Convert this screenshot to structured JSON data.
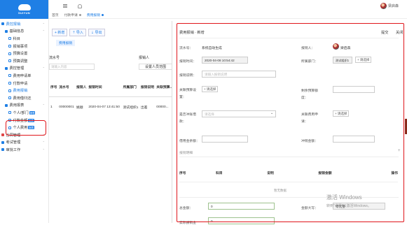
{
  "logo": {
    "brand": "SUIYUN"
  },
  "user": {
    "name": "梁启森"
  },
  "nav": {
    "items": [
      {
        "type": "group",
        "label": "费控报销",
        "icon": "expense-icon",
        "active": true
      },
      {
        "type": "sub",
        "label": "基础信息"
      },
      {
        "type": "leaf",
        "label": "科目"
      },
      {
        "type": "leaf",
        "label": "报销事项"
      },
      {
        "type": "leaf",
        "label": "预算设置"
      },
      {
        "type": "leaf",
        "label": "预算调整"
      },
      {
        "type": "sub",
        "label": "费控管理"
      },
      {
        "type": "leaf",
        "label": "费用申请单"
      },
      {
        "type": "leaf",
        "label": "付款申请"
      },
      {
        "type": "leaf",
        "label": "费用报销",
        "active": true
      },
      {
        "type": "leaf",
        "label": "费用借归还"
      },
      {
        "type": "sub",
        "label": "费用报表"
      },
      {
        "type": "leaf",
        "label": "个人/部门",
        "badge": "报表"
      },
      {
        "type": "leaf",
        "label": "付款金额",
        "badge": "报表"
      },
      {
        "type": "leaf",
        "label": "个人费用",
        "badge": "报表"
      },
      {
        "type": "group",
        "label": "合同管理"
      },
      {
        "type": "group",
        "label": "考试管理"
      },
      {
        "type": "group",
        "label": "审批工作"
      }
    ]
  },
  "tabs": [
    {
      "label": "首页",
      "active": false
    },
    {
      "label": "付款申请",
      "active": false
    },
    {
      "label": "费用报销",
      "active": true
    }
  ],
  "toolbar": {
    "add": "+ 新增",
    "import": "⇡ 导入",
    "export": "⇣ 导出"
  },
  "list": {
    "tab_label": "费用报销",
    "filter_no_label": "流水号",
    "filter_no_placeholder": "请输入内容",
    "filter_person_label": "报销人",
    "filter_person_btn": "设置人员范围",
    "columns": [
      "序号",
      "流水号",
      "报销人",
      "报销时间",
      "所属部门",
      "报销说明",
      "关联预算..."
    ],
    "rows": [
      {
        "seq": "1",
        "no": "00000001",
        "person": "姚顺",
        "time": "2020-04-07 13:41:50",
        "dept": "测试组织1",
        "desc": "出差",
        "budget": "00000..."
      }
    ]
  },
  "form": {
    "title": "费用报销 · 新增",
    "submit": "提交",
    "close": "关闭",
    "serial_label": "流水号：",
    "serial_value": "系统自动生成",
    "reporter_label": "报销人：",
    "reporter_value": "梁启森",
    "time_label": "报销时间：",
    "time_value": "2020-04-08 10:54:42",
    "dept_label": "所属部门：",
    "dept_value": "测试组织1",
    "dept_pick": "+ 请选择",
    "desc_label": "报销说明：",
    "desc_placeholder": "请输入报销说明",
    "budget_label1": "关联预算设",
    "budget_label2": "置：",
    "budget_pick": "+ 请选择",
    "budget_amount_label1": "剩余预算额",
    "budget_amount_label2": "度：",
    "offset_label1": "是否冲账借",
    "offset_label2": "款：",
    "offset_placeholder": "请选择",
    "apply_label1": "关联费用申",
    "apply_label2": "请：",
    "apply_pick": "+ 请选择",
    "loan_amount_label": "借用金余额：",
    "offset_amount_label": "冲销金额：",
    "detail_title": "报销明细",
    "detail_columns": [
      "序号",
      "科目",
      "说明",
      "报销金额",
      "操作"
    ],
    "empty_text": "暂无数据",
    "total_label": "总金额：",
    "total_value": "0",
    "total_upper_label": "金额大写：",
    "total_upper_value": "零元整",
    "actual_label": "实际报销金",
    "actual_value": "0"
  },
  "watermark": {
    "line1": "激活 Windows",
    "line2": "转到\"设置\"以激活Windows。"
  }
}
